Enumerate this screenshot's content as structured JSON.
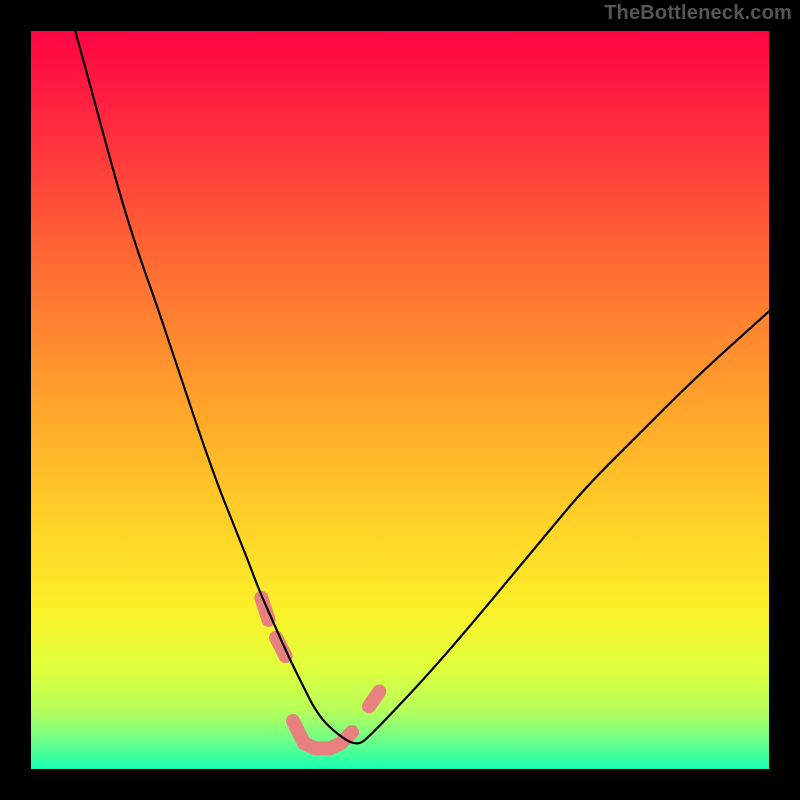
{
  "watermark": {
    "text": "TheBottleneck.com"
  },
  "colors": {
    "frame": "#000000",
    "gradient_top": "#ff0543",
    "gradient_bottom": "#18ffb3",
    "curve": "#000000",
    "highlight": "#e98080"
  },
  "chart_data": {
    "type": "line",
    "title": "",
    "xlabel": "",
    "ylabel": "",
    "xlim": [
      0,
      100
    ],
    "ylim": [
      0,
      100
    ],
    "grid": false,
    "legend": false,
    "note": "V-shaped bottleneck curve. Vertex region highlighted in pink near bottom of gradient. Axes not labeled; values are normalized 0–100 estimates read from pixel positions.",
    "series": [
      {
        "name": "bottleneck-curve",
        "x": [
          6.0,
          9.0,
          12.0,
          14.5,
          17.0,
          20.0,
          23.0,
          25.5,
          27.5,
          29.5,
          31.0,
          33.0,
          35.0,
          37.0,
          38.5,
          40.5,
          44.0,
          46.0,
          54.0,
          60.0,
          65.0,
          70.0,
          75.0,
          82.0,
          90.0,
          100.0
        ],
        "y": [
          100.0,
          89.0,
          78.0,
          70.0,
          63.0,
          54.0,
          45.0,
          38.0,
          33.0,
          28.0,
          24.0,
          19.5,
          15.0,
          11.0,
          8.0,
          5.5,
          3.0,
          4.5,
          13.0,
          20.0,
          26.0,
          32.0,
          38.0,
          45.0,
          53.0,
          62.0
        ]
      }
    ],
    "highlight_segments": [
      {
        "name": "left-upper-dot",
        "x": [
          31.2,
          32.2
        ],
        "y": [
          23.2,
          20.2
        ]
      },
      {
        "name": "left-lower-dot",
        "x": [
          33.2,
          34.5
        ],
        "y": [
          17.8,
          15.3
        ]
      },
      {
        "name": "vertex",
        "x": [
          35.5,
          37.0,
          38.5,
          40.5,
          42.0,
          43.5
        ],
        "y": [
          6.5,
          3.5,
          2.8,
          2.8,
          3.5,
          5.0
        ]
      },
      {
        "name": "right-dot",
        "x": [
          45.8,
          47.2
        ],
        "y": [
          8.5,
          10.5
        ]
      }
    ]
  }
}
